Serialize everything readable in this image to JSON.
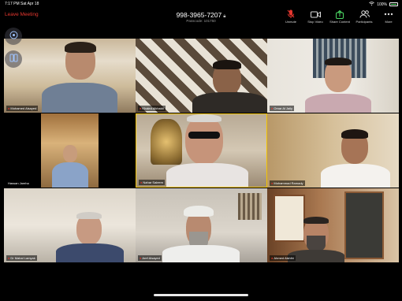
{
  "status": {
    "time": "7:17 PM",
    "day": "Sat Apr 18",
    "battery": "100%"
  },
  "meeting": {
    "leave_label": "Leave Meeting",
    "meeting_id": "998-3965-7207",
    "passcode": "Passcode: 101750"
  },
  "controls": [
    {
      "label": "Unmute",
      "icon": "mic-muted-icon"
    },
    {
      "label": "Stop Video",
      "icon": "video-icon"
    },
    {
      "label": "Share Content",
      "icon": "share-icon"
    },
    {
      "label": "Participants",
      "icon": "participants-icon"
    },
    {
      "label": "More",
      "icon": "more-icon"
    }
  ],
  "side_buttons": [
    "camera-switch-icon",
    "gallery-view-icon"
  ],
  "participants": [
    {
      "name": "Mohamed Alsayed"
    },
    {
      "name": "Khaled Alkhaldi"
    },
    {
      "name": "Omar Al Jaily"
    },
    {
      "name": "Hassan Jamha"
    },
    {
      "name": "Nahar Saleem"
    },
    {
      "name": "Mohammad Ramady"
    },
    {
      "name": "Dr Mahal Lamyak"
    },
    {
      "name": "Aref Alsayed"
    },
    {
      "name": "Ahmed Alshihi"
    }
  ],
  "colors": {
    "leave": "#e5372f",
    "mute": "#e5372f",
    "share": "#4cd964",
    "active_border": "#f2c400"
  }
}
